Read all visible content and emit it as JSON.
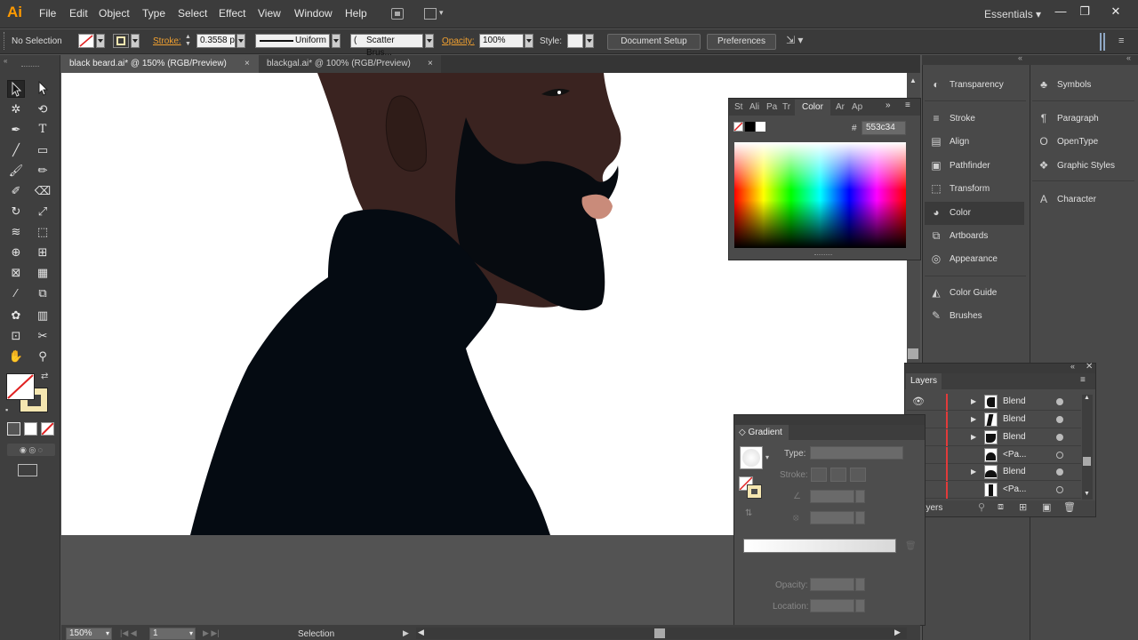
{
  "app": {
    "logo": "Ai",
    "menus": [
      "File",
      "Edit",
      "Object",
      "Type",
      "Select",
      "Effect",
      "View",
      "Window",
      "Help"
    ],
    "workspace": "Essentials",
    "window_buttons": [
      "—",
      "❐",
      "✕"
    ]
  },
  "control_bar": {
    "selection": "No Selection",
    "stroke_label": "Stroke:",
    "stroke_value": "0.3558 p",
    "stroke_profile": "Uniform",
    "brush": "Scatter Brus...",
    "opacity_label": "Opacity:",
    "opacity_value": "100%",
    "style_label": "Style:",
    "document_setup": "Document Setup",
    "preferences": "Preferences"
  },
  "tabs": [
    {
      "label": "black beard.ai* @ 150% (RGB/Preview)",
      "close": "×"
    },
    {
      "label": "blackgal.ai* @ 100% (RGB/Preview)",
      "close": "×"
    }
  ],
  "color_panel": {
    "tabs": [
      "St",
      "Ali",
      "Pa",
      "Tr",
      "Color",
      "Ar",
      "Ap"
    ],
    "hex_label": "#",
    "hex_value": "553c34",
    "swatch_color": "#553c34"
  },
  "dock_col1": [
    {
      "label": "Transparency",
      "icon": "transparency-icon",
      "glyph": "◐"
    },
    {
      "label": "Stroke",
      "icon": "stroke-icon",
      "glyph": "≡"
    },
    {
      "label": "Align",
      "icon": "align-icon",
      "glyph": "▤"
    },
    {
      "label": "Pathfinder",
      "icon": "pathfinder-icon",
      "glyph": "▣"
    },
    {
      "label": "Transform",
      "icon": "transform-icon",
      "glyph": "⬚"
    },
    {
      "label": "Color",
      "icon": "color-palette-icon",
      "glyph": "◕"
    },
    {
      "label": "Artboards",
      "icon": "artboards-icon",
      "glyph": "⧉"
    },
    {
      "label": "Appearance",
      "icon": "appearance-icon",
      "glyph": "◎"
    },
    {
      "label": "Color Guide",
      "icon": "color-guide-icon",
      "glyph": "◭"
    },
    {
      "label": "Brushes",
      "icon": "brushes-icon",
      "glyph": "✎"
    }
  ],
  "dock_col2": [
    {
      "label": "Symbols",
      "icon": "symbols-icon",
      "glyph": "♣"
    },
    {
      "label": "Paragraph",
      "icon": "paragraph-icon",
      "glyph": "¶"
    },
    {
      "label": "OpenType",
      "icon": "opentype-icon",
      "glyph": "O"
    },
    {
      "label": "Graphic Styles",
      "icon": "graphic-styles-icon",
      "glyph": "❖"
    },
    {
      "label": "Character",
      "icon": "character-icon",
      "glyph": "A"
    }
  ],
  "layers_panel": {
    "title": "Layers",
    "rows": [
      {
        "name": "Blend",
        "twirl": true,
        "target_filled": true
      },
      {
        "name": "Blend",
        "twirl": true,
        "target_filled": true
      },
      {
        "name": "Blend",
        "twirl": true,
        "target_filled": true
      },
      {
        "name": "<Pa...",
        "twirl": false,
        "target_filled": false
      },
      {
        "name": "Blend",
        "twirl": true,
        "target_filled": true
      },
      {
        "name": "<Pa...",
        "twirl": false,
        "target_filled": false
      }
    ],
    "count": "5 Layers"
  },
  "gradient_panel": {
    "title": "Gradient",
    "type_label": "Type:",
    "stroke_label": "Stroke:",
    "opacity_label": "Opacity:",
    "location_label": "Location:"
  },
  "status_bar": {
    "zoom": "150%",
    "artboard": "1",
    "tool": "Selection"
  },
  "colors": {
    "skin": "#3a2320",
    "beard": "#070b10",
    "lips": "#c98b7a",
    "accent": "#ff9a00"
  }
}
